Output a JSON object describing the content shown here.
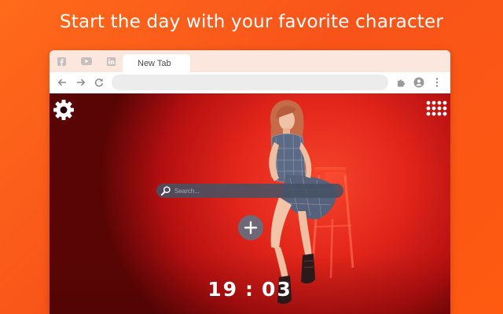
{
  "headline": "Start the day with your favorite character",
  "browser": {
    "tab_title": "New Tab",
    "bookmark_icons": [
      "facebook-icon",
      "youtube-icon",
      "linkedin-icon"
    ],
    "toolbar_icons": [
      "back-arrow-icon",
      "forward-arrow-icon",
      "reload-icon",
      "extensions-icon",
      "profile-icon",
      "menu-dots-icon"
    ]
  },
  "newtab": {
    "search": {
      "placeholder": "Search..."
    },
    "clock": {
      "hours": "19",
      "separator": ":",
      "minutes": "03"
    },
    "icons": [
      "gear-icon",
      "apps-grid-icon",
      "search-icon",
      "plus-icon"
    ]
  },
  "colors": {
    "page_background": "#f8541a",
    "tabstrip": "#fce7df",
    "wallpaper_red": "#e4261b",
    "search_bar": "#465264",
    "text_white": "#ffffff"
  }
}
